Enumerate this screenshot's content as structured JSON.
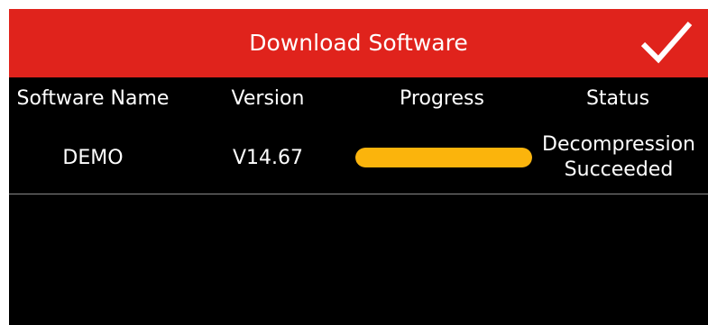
{
  "header": {
    "title": "Download Software",
    "confirm_icon": "checkmark-icon",
    "background_color": "#e0231c"
  },
  "table": {
    "columns": [
      "Software Name",
      "Version",
      "Progress",
      "Status"
    ],
    "rows": [
      {
        "name": "DEMO",
        "version": "V14.67",
        "progress": 1.0,
        "status": "Decompression\nSucceeded"
      }
    ]
  },
  "colors": {
    "progress_fill": "#fbb40c",
    "screen_background": "#000000"
  }
}
